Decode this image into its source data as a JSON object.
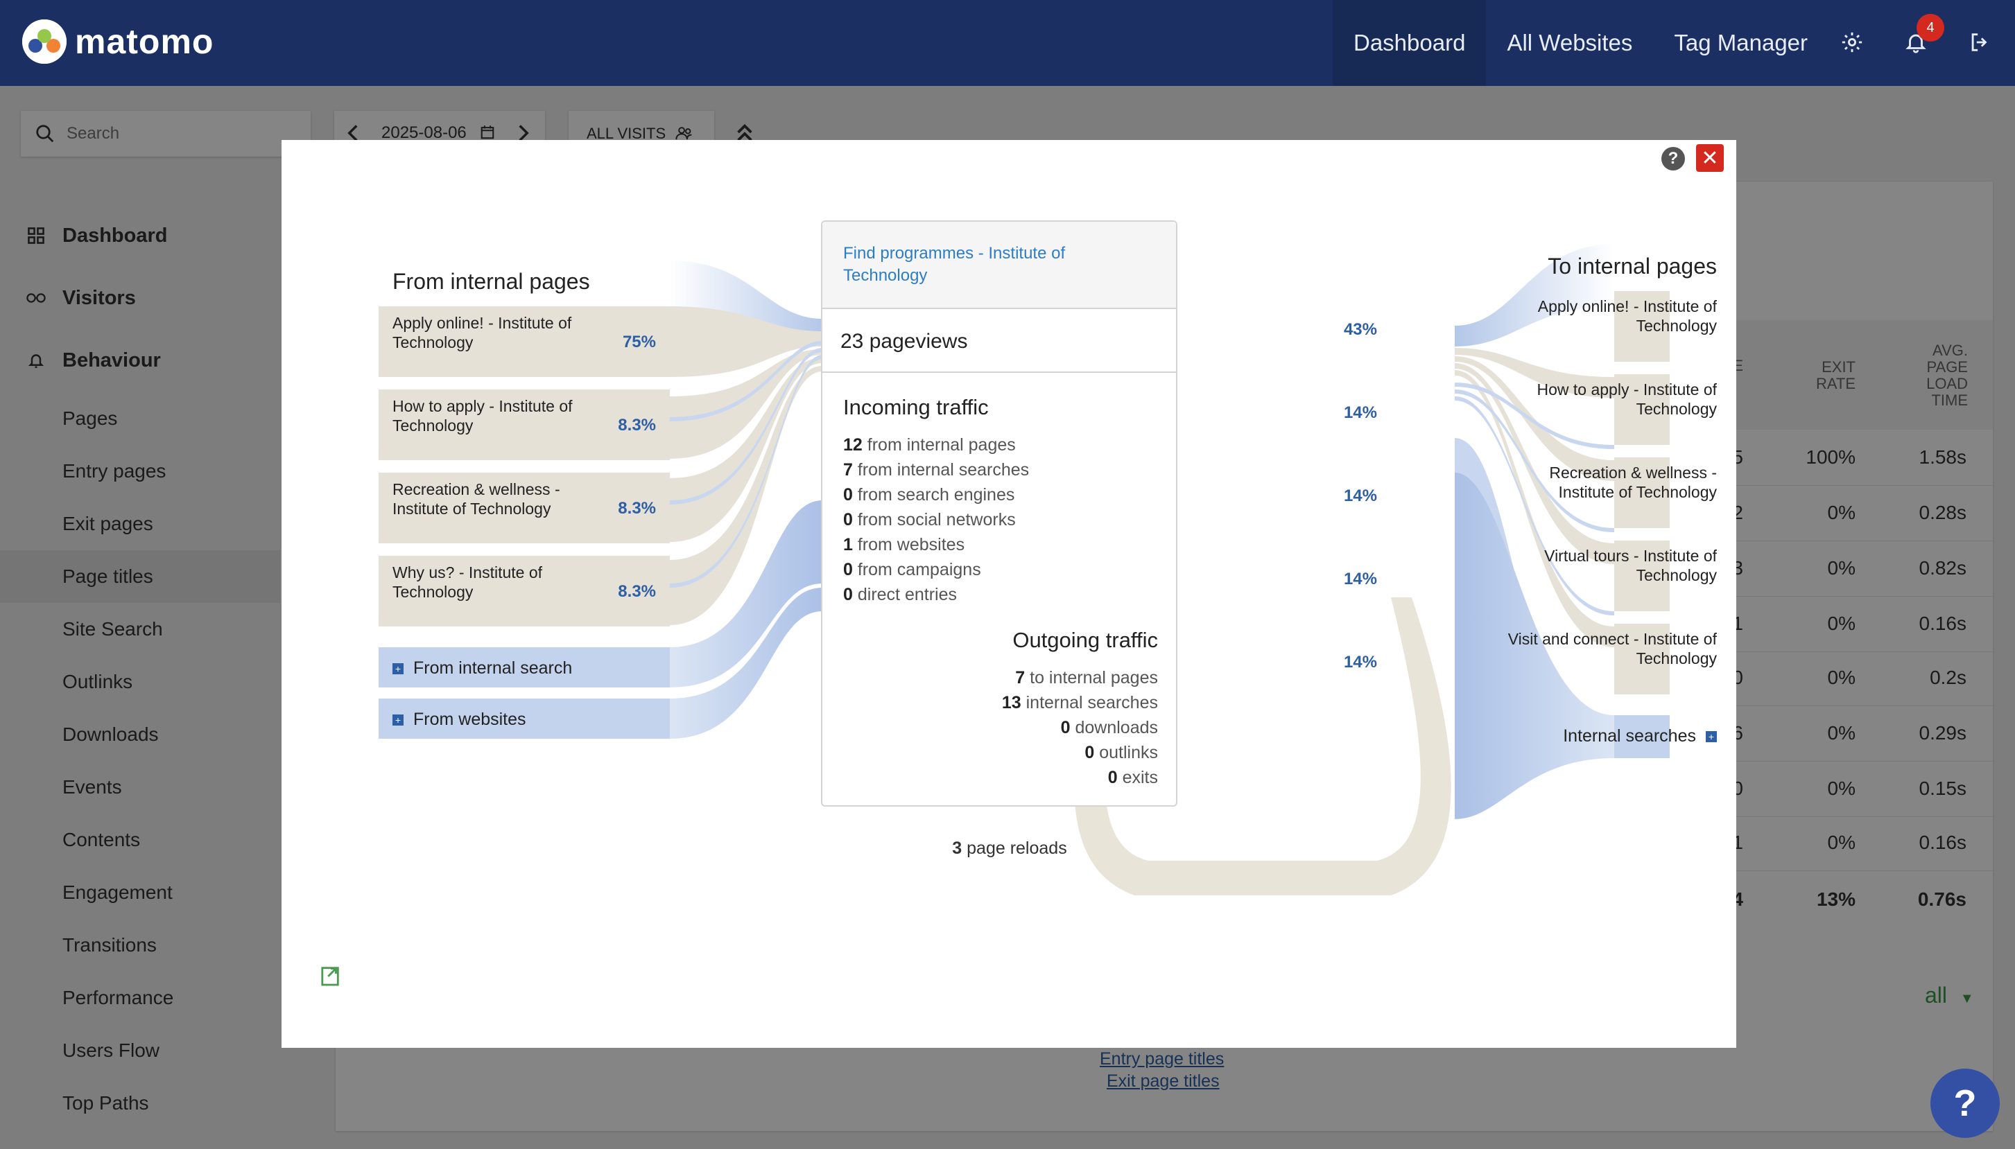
{
  "app": {
    "logo_text": "matomo"
  },
  "topnav": {
    "items": [
      "Dashboard",
      "All Websites",
      "Tag Manager"
    ],
    "notification_count": "4"
  },
  "colors": {
    "topbar": "#1b2f63",
    "accent_blue": "#2d5fa6",
    "flow_tan": "#e5e1d6",
    "flow_blue": "#b9cbe8",
    "close_red": "#d4291f"
  },
  "search": {
    "placeholder": "Search"
  },
  "period": {
    "date": "2025-08-06",
    "segment": "ALL VISITS"
  },
  "sidebar": {
    "main": [
      {
        "label": "Dashboard",
        "icon": "dashboard-icon"
      },
      {
        "label": "Visitors",
        "icon": "visitors-icon"
      },
      {
        "label": "Behaviour",
        "icon": "behaviour-icon"
      }
    ],
    "sub": [
      "Pages",
      "Entry pages",
      "Exit pages",
      "Page titles",
      "Site Search",
      "Outlinks",
      "Downloads",
      "Events",
      "Contents",
      "Engagement",
      "Transitions",
      "Performance",
      "Users Flow",
      "Top Paths"
    ],
    "selected": "Page titles"
  },
  "background_table": {
    "headers": {
      "exit_rate": "EXIT RATE",
      "avg_load": "AVG. PAGE LOAD TIME",
      "partial": "E"
    },
    "partial_col": [
      "5",
      "2",
      "3",
      "1",
      "0",
      "6",
      "0",
      "1",
      "4"
    ],
    "exit_rate": [
      "100%",
      "0%",
      "0%",
      "0%",
      "0%",
      "0%",
      "0%",
      "0%",
      "13%"
    ],
    "avg_load": [
      "1.58s",
      "0.28s",
      "0.82s",
      "0.16s",
      "0.2s",
      "0.29s",
      "0.15s",
      "0.16s",
      "0.76s"
    ],
    "limit_value": "all",
    "links": [
      "Entry page titles",
      "Exit page titles"
    ]
  },
  "transitions": {
    "page_title": "Find programmes - Institute of Technology",
    "pageviews": "23 pageviews",
    "left_title": "From internal pages",
    "right_title": "To internal pages",
    "incoming_title": "Incoming traffic",
    "outgoing_title": "Outgoing traffic",
    "incoming": [
      {
        "n": "12",
        "t": "from internal pages"
      },
      {
        "n": "7",
        "t": "from internal searches"
      },
      {
        "n": "0",
        "t": "from search engines"
      },
      {
        "n": "0",
        "t": "from social networks"
      },
      {
        "n": "1",
        "t": "from websites"
      },
      {
        "n": "0",
        "t": "from campaigns"
      },
      {
        "n": "0",
        "t": "direct entries"
      }
    ],
    "outgoing": [
      {
        "n": "7",
        "t": "to internal pages"
      },
      {
        "n": "13",
        "t": "internal searches"
      },
      {
        "n": "0",
        "t": "downloads"
      },
      {
        "n": "0",
        "t": "outlinks"
      },
      {
        "n": "0",
        "t": "exits"
      }
    ],
    "reloads": {
      "n": "3",
      "t": "page reloads"
    },
    "left_pages": [
      {
        "line1": "Apply online! - Institute of",
        "line2": "Technology",
        "pct": "75%"
      },
      {
        "line1": "How to apply - Institute of",
        "line2": "Technology",
        "pct": "8.3%"
      },
      {
        "line1": "Recreation & wellness -",
        "line2": "Institute of Technology",
        "pct": "8.3%"
      },
      {
        "line1": "Why us? - Institute of",
        "line2": "Technology",
        "pct": "8.3%"
      }
    ],
    "left_groups": [
      "From internal search",
      "From websites"
    ],
    "right_pages": [
      {
        "line1": "Apply online! - Institute of",
        "line2": "Technology",
        "pct": "43%"
      },
      {
        "line1": "How to apply - Institute of",
        "line2": "Technology",
        "pct": "14%"
      },
      {
        "line1": "Recreation & wellness -",
        "line2": "Institute of Technology",
        "pct": "14%"
      },
      {
        "line1": "Virtual tours - Institute of",
        "line2": "Technology",
        "pct": "14%"
      },
      {
        "line1": "Visit and connect - Institute of",
        "line2": "Technology",
        "pct": "14%"
      }
    ],
    "right_groups": [
      "Internal searches"
    ]
  }
}
